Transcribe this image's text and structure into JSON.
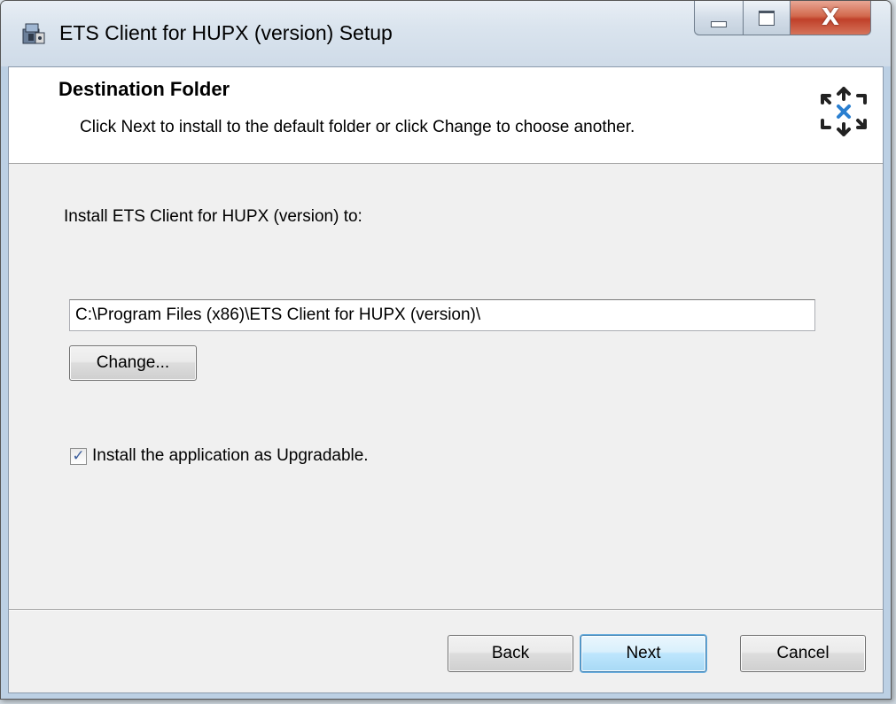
{
  "window": {
    "title": "ETS Client for HUPX (version) Setup",
    "close_glyph": "X"
  },
  "header": {
    "title": "Destination Folder",
    "subtitle": "Click Next to install to the default folder or click Change to choose another."
  },
  "main": {
    "install_label": "Install ETS Client for HUPX (version) to:",
    "install_path": "C:\\Program Files (x86)\\ETS Client for HUPX (version)\\",
    "change_button": "Change...",
    "upgradable_checkbox": {
      "label": "Install the application as Upgradable.",
      "checked": true,
      "check_glyph": "✓"
    }
  },
  "footer": {
    "back_button": "Back",
    "next_button": "Next",
    "cancel_button": "Cancel"
  },
  "colors": {
    "accent": "#3c7fb1",
    "close_button": "#c0402a",
    "logo": "#2a7fd0"
  },
  "icons": {
    "app": "installer-package-icon",
    "logo": "ets-arrows-logo-icon"
  }
}
